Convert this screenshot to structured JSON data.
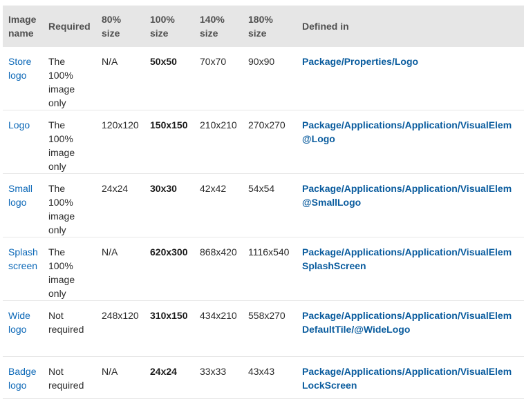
{
  "headers": [
    "Image name",
    "Required",
    "80% size",
    "100% size",
    "140% size",
    "180% size",
    "Defined in"
  ],
  "rows": [
    {
      "name": "Store logo",
      "required": "The 100% image only",
      "s80": "N/A",
      "s100": "50x50",
      "s140": "70x70",
      "s180": "90x90",
      "defined_line1": "Package/Properties/Logo",
      "defined_line2": ""
    },
    {
      "name": "Logo",
      "required": "The 100% image only",
      "s80": "120x120",
      "s100": "150x150",
      "s140": "210x210",
      "s180": "270x270",
      "defined_line1": "Package/Applications/Application/VisualElem",
      "defined_line2": "@Logo"
    },
    {
      "name": "Small logo",
      "required": "The 100% image only",
      "s80": "24x24",
      "s100": "30x30",
      "s140": "42x42",
      "s180": "54x54",
      "defined_line1": "Package/Applications/Application/VisualElem",
      "defined_line2": "@SmallLogo"
    },
    {
      "name": "Splash screen",
      "required": "The 100% image only",
      "s80": "N/A",
      "s100": "620x300",
      "s140": "868x420",
      "s180": "1116x540",
      "defined_line1": "Package/Applications/Application/VisualElem",
      "defined_line2": "SplashScreen"
    },
    {
      "name": "Wide logo",
      "required": "Not required",
      "s80": "248x120",
      "s100": "310x150",
      "s140": "434x210",
      "s180": "558x270",
      "defined_line1": "Package/Applications/Application/VisualElem",
      "defined_line2": "DefaultTile/@WideLogo"
    },
    {
      "name": "Badge logo",
      "required": "Not required",
      "s80": "N/A",
      "s100": "24x24",
      "s140": "33x33",
      "s180": "43x43",
      "defined_line1": "Package/Applications/Application/VisualElem",
      "defined_line2": "LockScreen"
    }
  ]
}
